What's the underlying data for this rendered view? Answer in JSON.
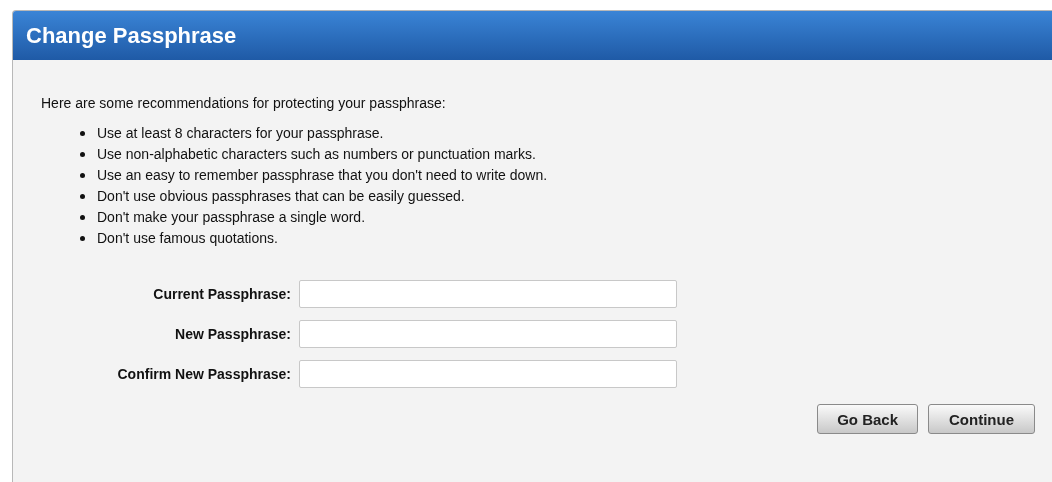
{
  "panel": {
    "title": "Change Passphrase"
  },
  "intro": "Here are some recommendations for protecting your passphrase:",
  "recommendations": [
    "Use at least 8 characters for your passphrase.",
    "Use non-alphabetic characters such as numbers or punctuation marks.",
    "Use an easy to remember passphrase that you don't need to write down.",
    "Don't use obvious passphrases that can be easily guessed.",
    "Don't make your passphrase a single word.",
    "Don't use famous quotations."
  ],
  "fields": [
    {
      "label": "Current Passphrase:"
    },
    {
      "label": "New Passphrase:"
    },
    {
      "label": "Confirm New Passphrase:"
    }
  ],
  "buttons": [
    "Go Back",
    "Continue"
  ]
}
